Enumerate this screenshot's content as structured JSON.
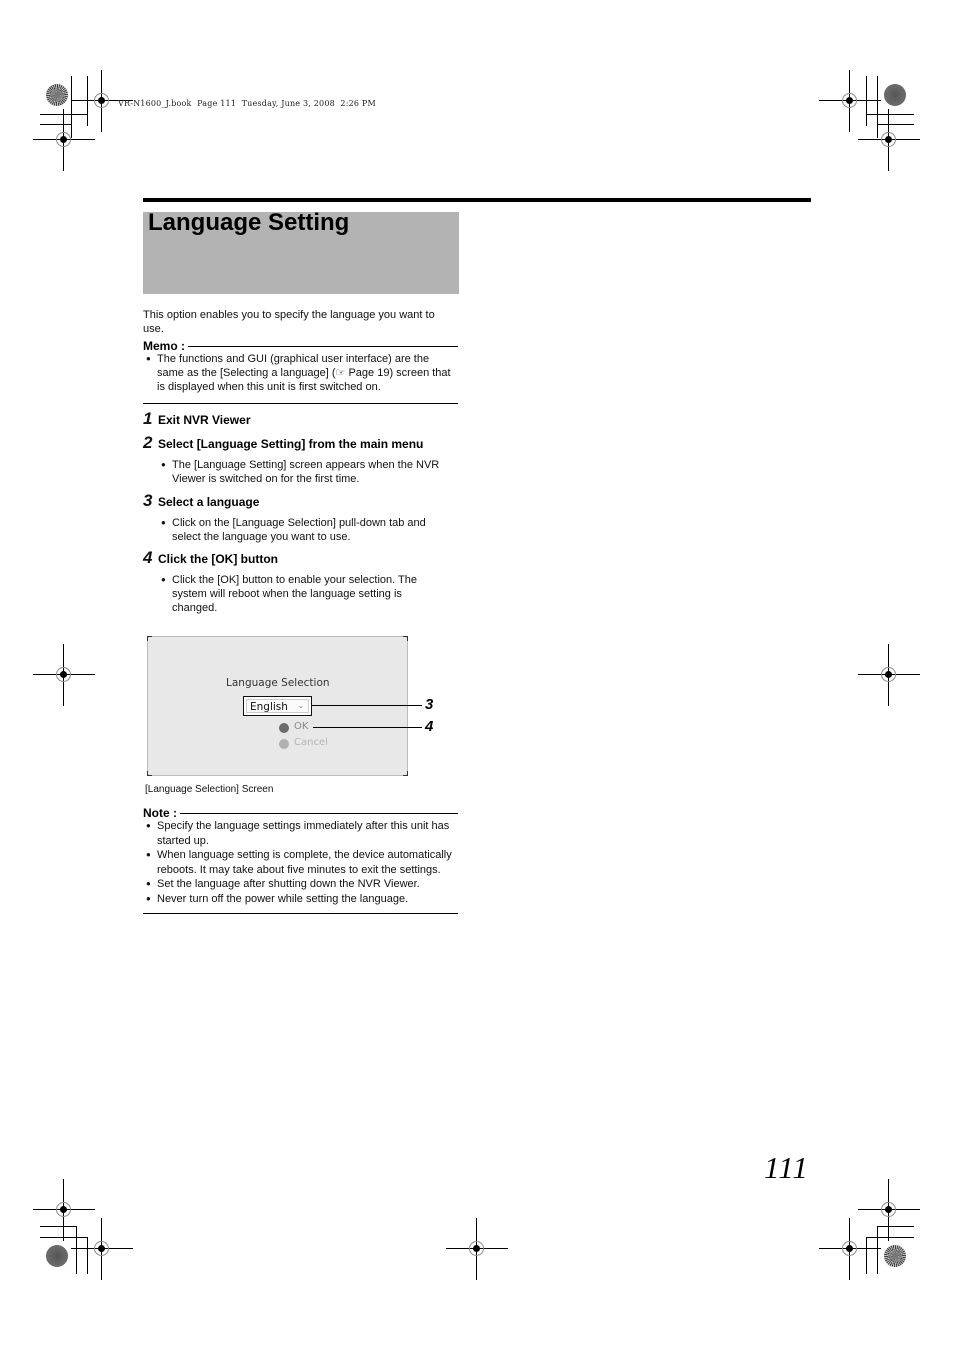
{
  "print_header": {
    "text": "VR-N1600_J.book  Page 111  Tuesday, June 3, 2008  2:26 PM"
  },
  "section": {
    "title": "Language Setting",
    "intro": "This option enables you to specify the language you want to use."
  },
  "memo": {
    "label": "Memo :",
    "items": [
      "The functions and GUI (graphical user interface) are the same as the [Selecting a language] (☞ Page 19) screen that is displayed when this unit is first switched on."
    ]
  },
  "steps": [
    {
      "number": "1",
      "title": "Exit NVR Viewer",
      "bullets": []
    },
    {
      "number": "2",
      "title": "Select [Language Setting] from the main menu",
      "bullets": [
        "The [Language Setting] screen appears when the NVR Viewer is switched on for the first time."
      ]
    },
    {
      "number": "3",
      "title": "Select a language",
      "bullets": [
        "Click on the [Language Selection] pull-down tab and select the language you want to use."
      ]
    },
    {
      "number": "4",
      "title": "Click the [OK] button",
      "bullets": [
        "Click the [OK] button to enable your selection.  The system will reboot when the language setting is changed."
      ]
    }
  ],
  "screenshot": {
    "label": "Language Selection",
    "dropdown_value": "English",
    "dropdown_icon": "chevron-down-icon",
    "ok_label": "OK",
    "cancel_label": "Cancel",
    "callouts": [
      "3",
      "4"
    ],
    "caption": "[Language Selection] Screen",
    "colors": {
      "panel": "#e8e8e8",
      "ok_radio": "#6b6b6b",
      "cancel_radio": "#b0b0b0",
      "ok_text": "#8a8a8a",
      "cancel_text": "#b5b5b5"
    }
  },
  "note": {
    "label": "Note :",
    "items": [
      "Specify the language settings immediately after this unit has started up.",
      "When language setting is complete, the device automatically reboots.  It may take about five minutes to exit the settings.",
      "Set the language after shutting down the NVR Viewer.",
      "Never turn off the power while setting the language."
    ]
  },
  "page_number": "111",
  "colors": {
    "title_band": "#b3b3b3",
    "text": "#111111"
  }
}
